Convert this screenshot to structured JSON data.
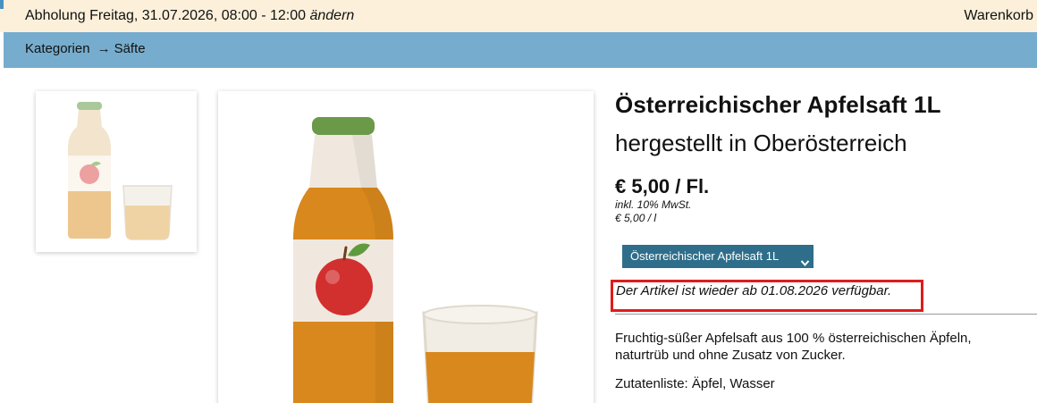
{
  "header": {
    "pickup_text": "Abholung Freitag, 31.07.2026, 08:00 - 12:00",
    "change_link": "ändern",
    "cart_label": "Warenkorb"
  },
  "breadcrumb": {
    "category": "Kategorien",
    "arrow": "→",
    "current": "Säfte"
  },
  "product": {
    "title": "Österreichischer Apfelsaft 1L",
    "subtitle": "hergestellt in Oberösterreich",
    "price": "€ 5,00 / Fl.",
    "tax_note": "inkl. 10% MwSt.",
    "unit_price": "€ 5,00 / l",
    "variant_selected": "Österreichischer Apfelsaft 1L",
    "availability": "Der Artikel ist wieder ab 01.08.2026 verfügbar.",
    "description": "Fruchtig-süßer Apfelsaft aus 100 % österreichischen Äpfeln, naturtrüb und ohne Zusatz von Zucker.",
    "ingredients": "Zutatenliste: Äpfel, Wasser"
  },
  "colors": {
    "header_bg": "#fdf0da",
    "category_bar_bg": "#76adce",
    "variant_select_bg": "#2f6e8a",
    "highlight_border": "#e01b1b",
    "juice": "#d8881c",
    "bottle_cap": "#6a9a48",
    "apple": "#d22f2f"
  },
  "icons": {
    "variant_dropdown": "chevron-down-icon",
    "thumbnail": "juice-bottle-icon",
    "product_image": "juice-bottle-glass-illustration"
  }
}
